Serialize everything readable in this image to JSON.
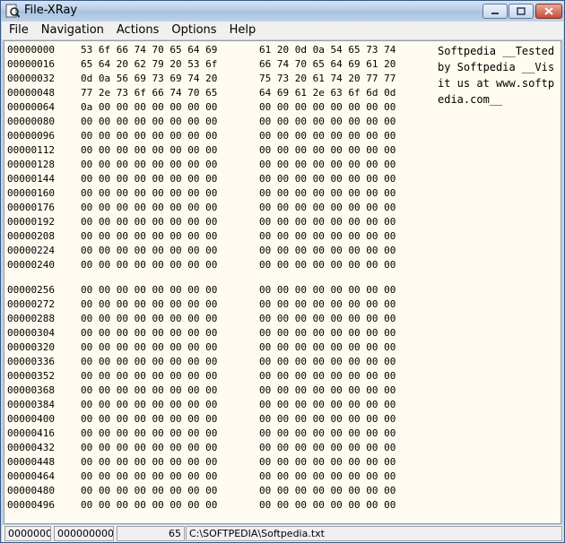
{
  "window": {
    "title": "File-XRay"
  },
  "menu": [
    "File",
    "Navigation",
    "Actions",
    "Options",
    "Help"
  ],
  "hex_rows": [
    {
      "offset": "00000000",
      "a": "53 6f 66 74 70 65 64 69",
      "b": "61 20 0d 0a 54 65 73 74"
    },
    {
      "offset": "00000016",
      "a": "65 64 20 62 79 20 53 6f",
      "b": "66 74 70 65 64 69 61 20"
    },
    {
      "offset": "00000032",
      "a": "0d 0a 56 69 73 69 74 20",
      "b": "75 73 20 61 74 20 77 77"
    },
    {
      "offset": "00000048",
      "a": "77 2e 73 6f 66 74 70 65",
      "b": "64 69 61 2e 63 6f 6d 0d"
    },
    {
      "offset": "00000064",
      "a": "0a 00 00 00 00 00 00 00",
      "b": "00 00 00 00 00 00 00 00"
    },
    {
      "offset": "00000080",
      "a": "00 00 00 00 00 00 00 00",
      "b": "00 00 00 00 00 00 00 00"
    },
    {
      "offset": "00000096",
      "a": "00 00 00 00 00 00 00 00",
      "b": "00 00 00 00 00 00 00 00"
    },
    {
      "offset": "00000112",
      "a": "00 00 00 00 00 00 00 00",
      "b": "00 00 00 00 00 00 00 00"
    },
    {
      "offset": "00000128",
      "a": "00 00 00 00 00 00 00 00",
      "b": "00 00 00 00 00 00 00 00"
    },
    {
      "offset": "00000144",
      "a": "00 00 00 00 00 00 00 00",
      "b": "00 00 00 00 00 00 00 00"
    },
    {
      "offset": "00000160",
      "a": "00 00 00 00 00 00 00 00",
      "b": "00 00 00 00 00 00 00 00"
    },
    {
      "offset": "00000176",
      "a": "00 00 00 00 00 00 00 00",
      "b": "00 00 00 00 00 00 00 00"
    },
    {
      "offset": "00000192",
      "a": "00 00 00 00 00 00 00 00",
      "b": "00 00 00 00 00 00 00 00"
    },
    {
      "offset": "00000208",
      "a": "00 00 00 00 00 00 00 00",
      "b": "00 00 00 00 00 00 00 00"
    },
    {
      "offset": "00000224",
      "a": "00 00 00 00 00 00 00 00",
      "b": "00 00 00 00 00 00 00 00"
    },
    {
      "offset": "00000240",
      "a": "00 00 00 00 00 00 00 00",
      "b": "00 00 00 00 00 00 00 00"
    },
    {
      "offset": "00000256",
      "a": "00 00 00 00 00 00 00 00",
      "b": "00 00 00 00 00 00 00 00"
    },
    {
      "offset": "00000272",
      "a": "00 00 00 00 00 00 00 00",
      "b": "00 00 00 00 00 00 00 00"
    },
    {
      "offset": "00000288",
      "a": "00 00 00 00 00 00 00 00",
      "b": "00 00 00 00 00 00 00 00"
    },
    {
      "offset": "00000304",
      "a": "00 00 00 00 00 00 00 00",
      "b": "00 00 00 00 00 00 00 00"
    },
    {
      "offset": "00000320",
      "a": "00 00 00 00 00 00 00 00",
      "b": "00 00 00 00 00 00 00 00"
    },
    {
      "offset": "00000336",
      "a": "00 00 00 00 00 00 00 00",
      "b": "00 00 00 00 00 00 00 00"
    },
    {
      "offset": "00000352",
      "a": "00 00 00 00 00 00 00 00",
      "b": "00 00 00 00 00 00 00 00"
    },
    {
      "offset": "00000368",
      "a": "00 00 00 00 00 00 00 00",
      "b": "00 00 00 00 00 00 00 00"
    },
    {
      "offset": "00000384",
      "a": "00 00 00 00 00 00 00 00",
      "b": "00 00 00 00 00 00 00 00"
    },
    {
      "offset": "00000400",
      "a": "00 00 00 00 00 00 00 00",
      "b": "00 00 00 00 00 00 00 00"
    },
    {
      "offset": "00000416",
      "a": "00 00 00 00 00 00 00 00",
      "b": "00 00 00 00 00 00 00 00"
    },
    {
      "offset": "00000432",
      "a": "00 00 00 00 00 00 00 00",
      "b": "00 00 00 00 00 00 00 00"
    },
    {
      "offset": "00000448",
      "a": "00 00 00 00 00 00 00 00",
      "b": "00 00 00 00 00 00 00 00"
    },
    {
      "offset": "00000464",
      "a": "00 00 00 00 00 00 00 00",
      "b": "00 00 00 00 00 00 00 00"
    },
    {
      "offset": "00000480",
      "a": "00 00 00 00 00 00 00 00",
      "b": "00 00 00 00 00 00 00 00"
    },
    {
      "offset": "00000496",
      "a": "00 00 00 00 00 00 00 00",
      "b": "00 00 00 00 00 00 00 00"
    }
  ],
  "ascii_text": "Softpedia __Tested by Softpedia __Visit us at www.softpedia.com__",
  "status": {
    "offset": "0000000",
    "position": "0000000000",
    "size": "65",
    "file_path": "C:\\SOFTPEDIA\\Softpedia.txt"
  },
  "colors": {
    "content_bg": "#fffbf0",
    "frame": "#bfd3ea",
    "close_button": "#c84a36"
  },
  "icons": [
    "app-icon",
    "minimize-icon",
    "maximize-icon",
    "close-icon"
  ]
}
